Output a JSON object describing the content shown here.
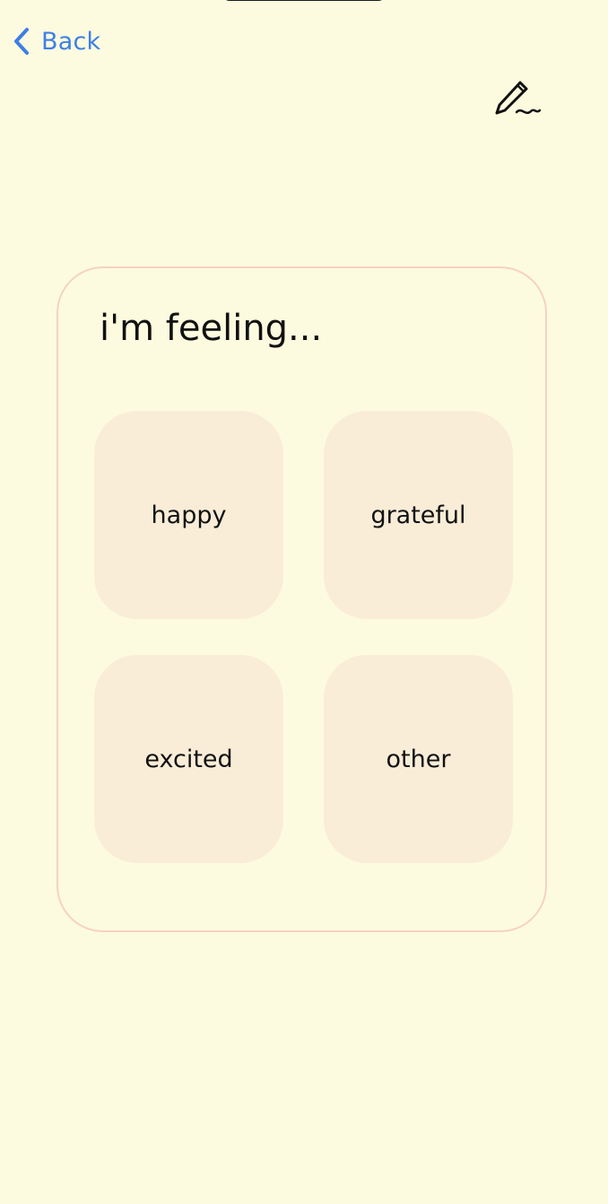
{
  "nav": {
    "back_label": "Back",
    "back_icon": "chevron-left-icon",
    "edit_icon": "pen-signature-icon",
    "accent_color": "#3D7FE6"
  },
  "card": {
    "title": "i'm feeling...",
    "options": [
      "happy",
      "grateful",
      "excited",
      "other"
    ]
  },
  "colors": {
    "background": "#FDFBDF",
    "card_border": "#F6D2C2",
    "tile_fill": "#FAEDD8"
  }
}
